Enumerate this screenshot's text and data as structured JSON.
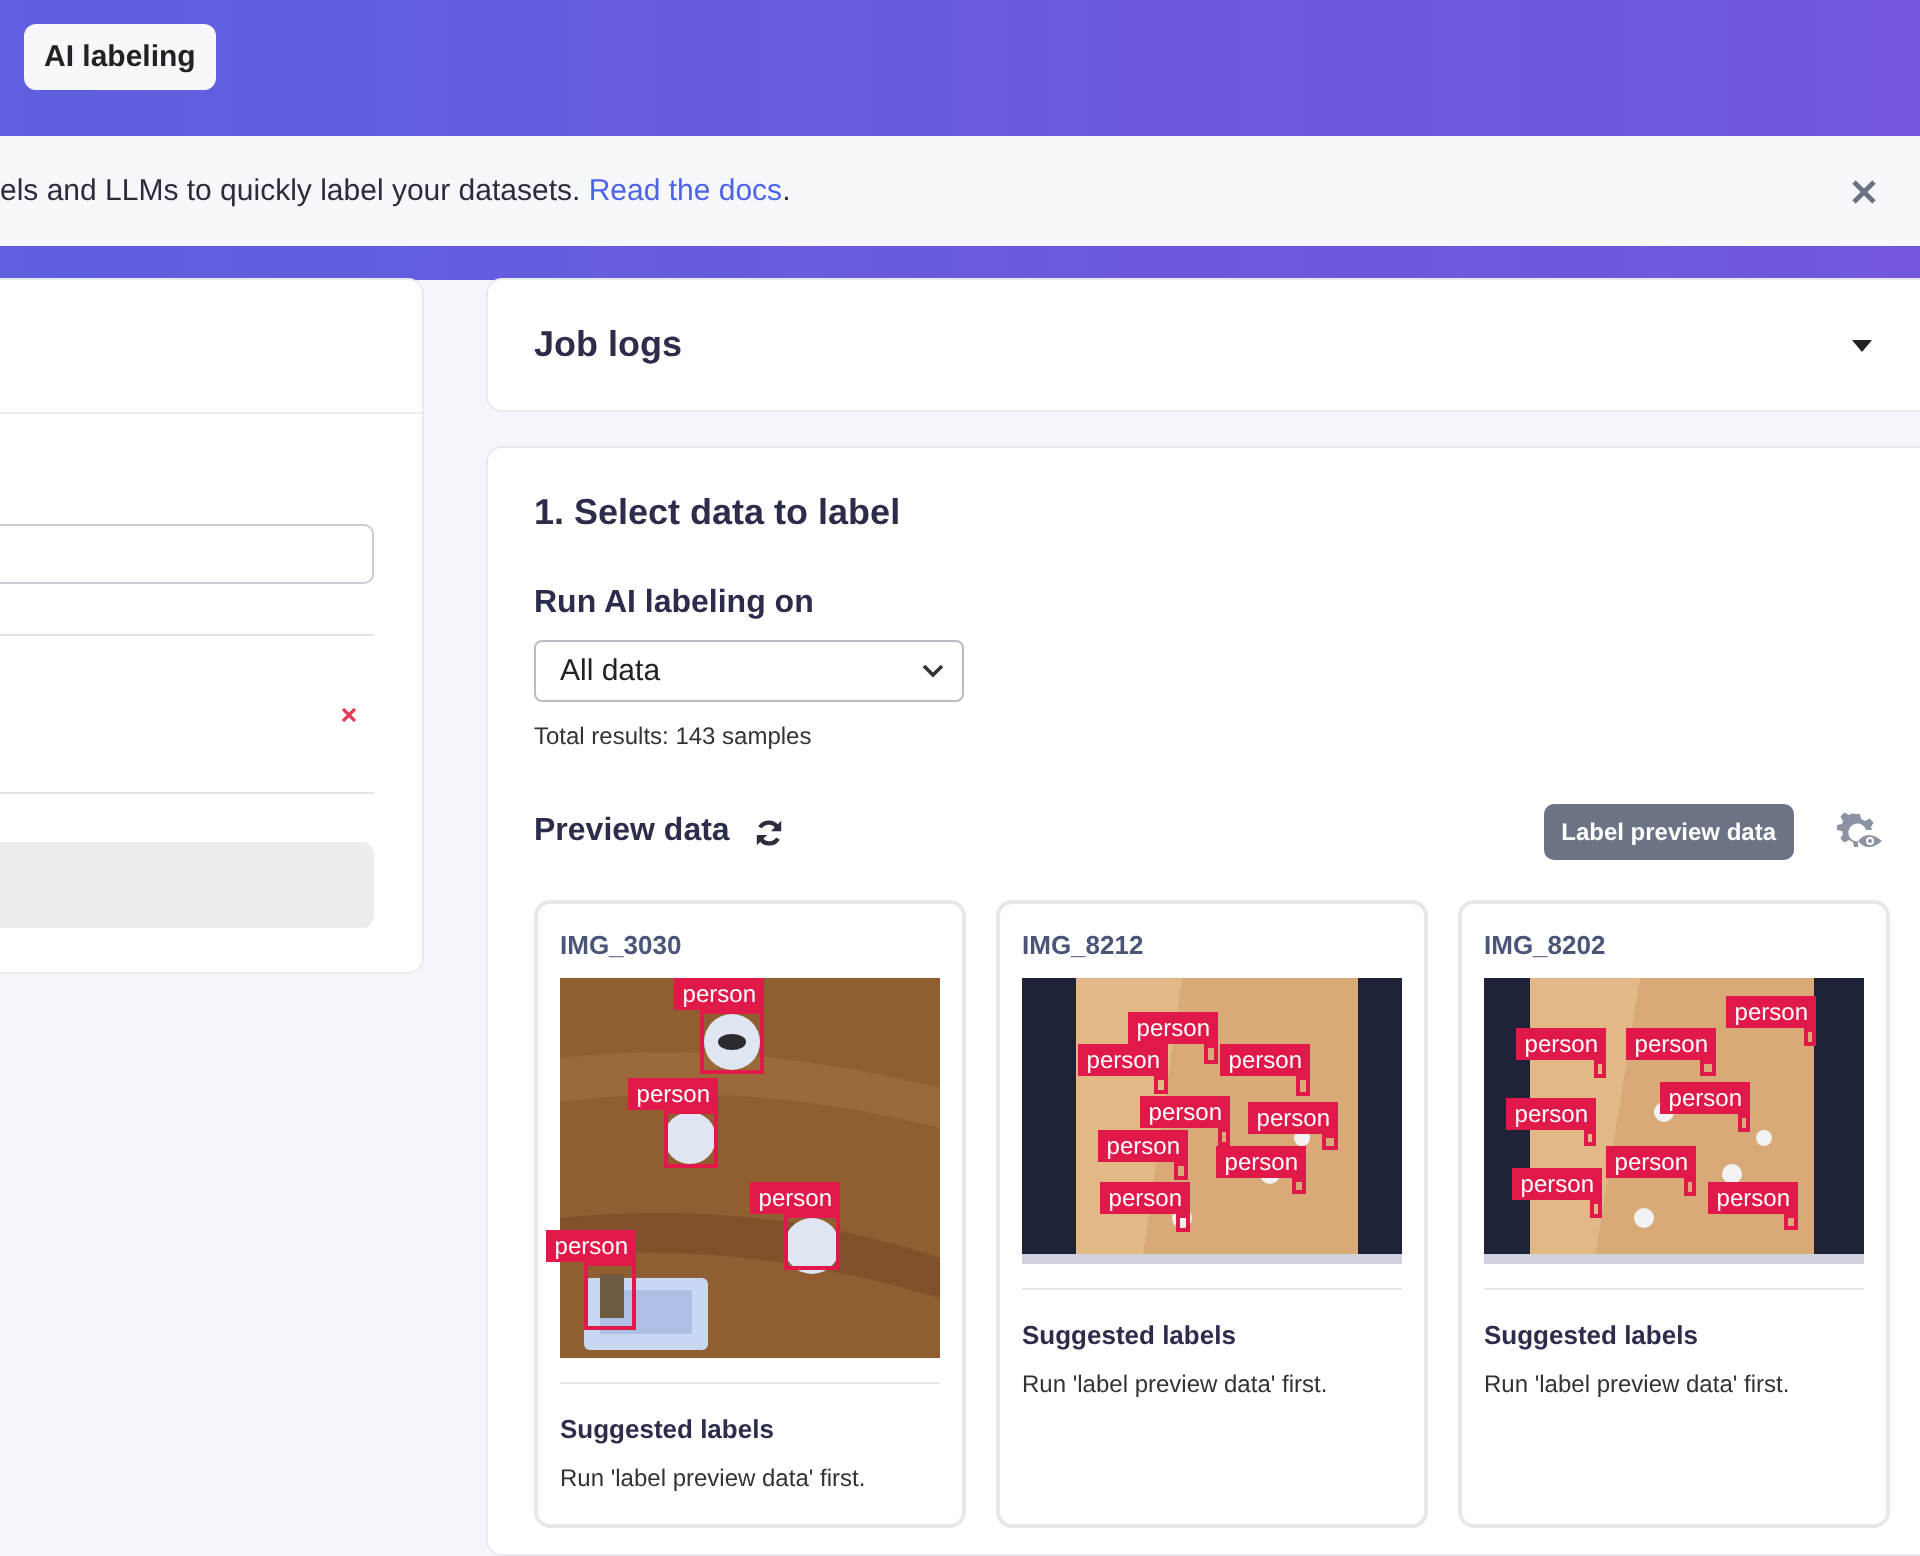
{
  "header": {
    "tab": "AI labeling"
  },
  "banner": {
    "text": "els and LLMs to quickly label your datasets. ",
    "link": "Read the docs",
    "after": "."
  },
  "job_logs": {
    "title": "Job logs",
    "expanded": false
  },
  "select_data": {
    "title": "1. Select data to label",
    "run_on_label": "Run AI labeling on",
    "run_on_value": "All data",
    "total": "Total results: 143 samples",
    "preview_title": "Preview data",
    "preview_button": "Label preview data"
  },
  "samples": [
    {
      "name": "IMG_3030",
      "detections": [
        {
          "label": "person"
        },
        {
          "label": "person"
        },
        {
          "label": "person"
        },
        {
          "label": "person"
        }
      ],
      "suggested_title": "Suggested labels",
      "suggested_text": "Run 'label preview data' first."
    },
    {
      "name": "IMG_8212",
      "detections": [
        {
          "label": "person"
        },
        {
          "label": "person"
        },
        {
          "label": "person"
        },
        {
          "label": "person"
        },
        {
          "label": "person"
        },
        {
          "label": "person"
        },
        {
          "label": "person"
        },
        {
          "label": "person"
        }
      ],
      "suggested_title": "Suggested labels",
      "suggested_text": "Run 'label preview data' first."
    },
    {
      "name": "IMG_8202",
      "detections": [
        {
          "label": "person"
        },
        {
          "label": "person"
        },
        {
          "label": "person"
        },
        {
          "label": "person"
        },
        {
          "label": "person"
        },
        {
          "label": "person"
        },
        {
          "label": "person"
        },
        {
          "label": "person"
        }
      ],
      "suggested_title": "Suggested labels",
      "suggested_text": "Run 'label preview data' first."
    }
  ]
}
